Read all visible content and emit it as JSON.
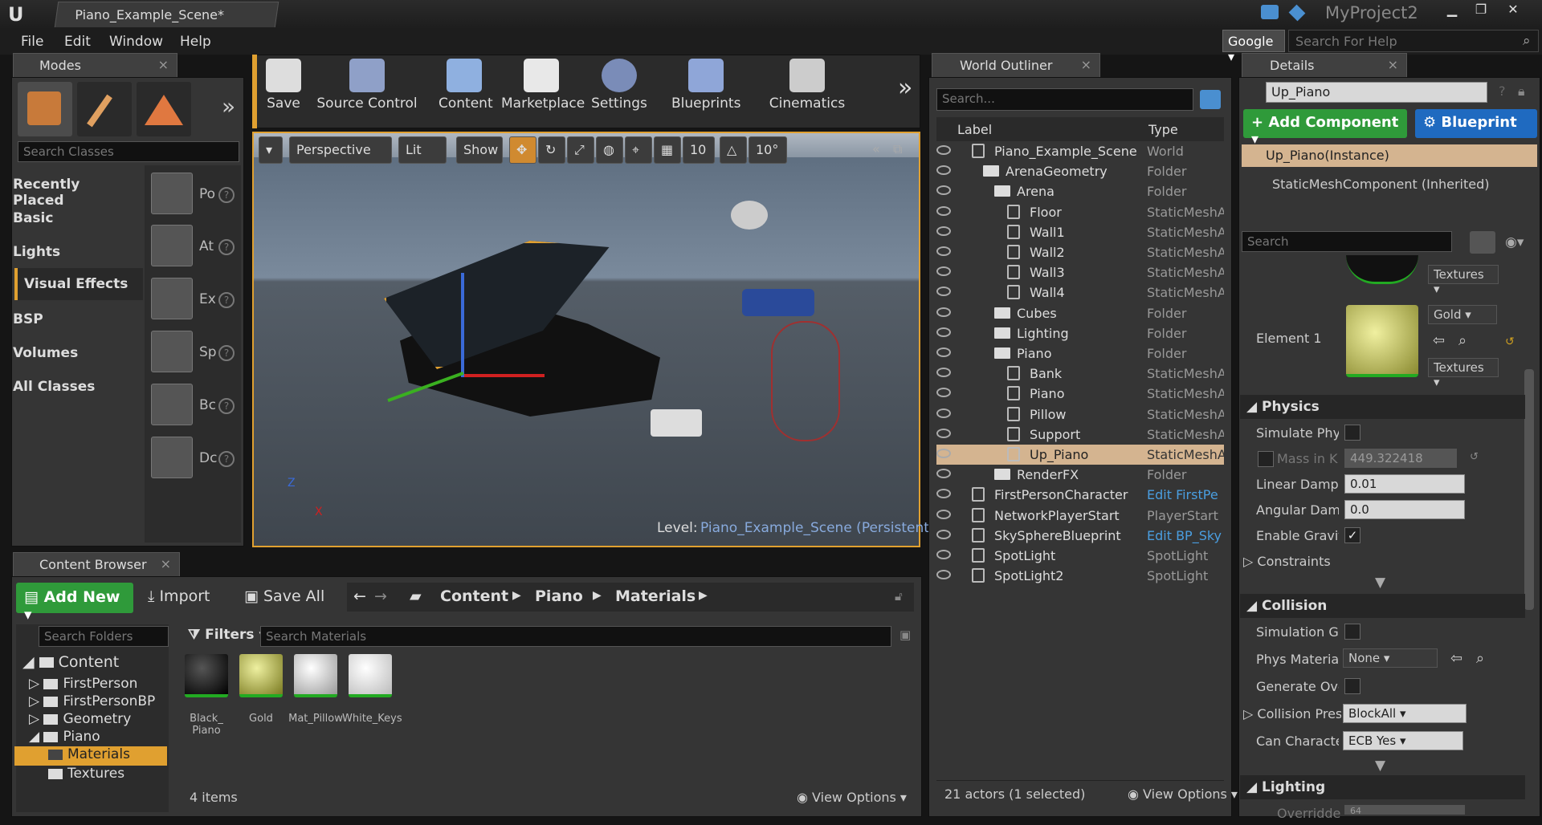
{
  "app": {
    "tab_title": "Piano_Example_Scene*",
    "project": "MyProject2",
    "logo": "U"
  },
  "menu": [
    "File",
    "Edit",
    "Window",
    "Help"
  ],
  "help": {
    "engine": "Google",
    "placeholder": "Search For Help"
  },
  "modes": {
    "tab": "Modes",
    "search_placeholder": "Search Classes",
    "categories": [
      "Recently Placed",
      "Basic",
      "Lights",
      "Visual Effects",
      "BSP",
      "Volumes",
      "All Classes"
    ],
    "placeables": [
      "Po",
      "At",
      "Ex",
      "Sp",
      "Bc",
      "Dc"
    ]
  },
  "toolbar": [
    "Save",
    "Source Control",
    "Content",
    "Marketplace",
    "Settings",
    "Blueprints",
    "Cinematics"
  ],
  "viewport": {
    "perspective": "Perspective",
    "lit": "Lit",
    "show": "Show",
    "grid": "10",
    "angle": "10°",
    "level_label": "Level:",
    "level_name": "Piano_Example_Scene (Persistent)",
    "axis_z": "Z",
    "axis_x": "X"
  },
  "outliner": {
    "tab": "World Outliner",
    "search_placeholder": "Search...",
    "col_label": "Label",
    "col_type": "Type",
    "rows": [
      {
        "label": "Piano_Example_Scene",
        "type": "World"
      },
      {
        "label": "ArenaGeometry",
        "type": "Folder"
      },
      {
        "label": "Arena",
        "type": "Folder"
      },
      {
        "label": "Floor",
        "type": "StaticMeshA"
      },
      {
        "label": "Wall1",
        "type": "StaticMeshA"
      },
      {
        "label": "Wall2",
        "type": "StaticMeshA"
      },
      {
        "label": "Wall3",
        "type": "StaticMeshA"
      },
      {
        "label": "Wall4",
        "type": "StaticMeshA"
      },
      {
        "label": "Cubes",
        "type": "Folder"
      },
      {
        "label": "Lighting",
        "type": "Folder"
      },
      {
        "label": "Piano",
        "type": "Folder"
      },
      {
        "label": "Bank",
        "type": "StaticMeshA"
      },
      {
        "label": "Piano",
        "type": "StaticMeshA"
      },
      {
        "label": "Pillow",
        "type": "StaticMeshA"
      },
      {
        "label": "Support",
        "type": "StaticMeshA"
      },
      {
        "label": "Up_Piano",
        "type": "StaticMeshA"
      },
      {
        "label": "RenderFX",
        "type": "Folder"
      },
      {
        "label": "FirstPersonCharacter",
        "type": "Edit FirstPe"
      },
      {
        "label": "NetworkPlayerStart",
        "type": "PlayerStart"
      },
      {
        "label": "SkySphereBlueprint",
        "type": "Edit BP_Sky"
      },
      {
        "label": "SpotLight",
        "type": "SpotLight"
      },
      {
        "label": "SpotLight2",
        "type": "SpotLight"
      }
    ],
    "status": "21 actors (1 selected)",
    "view_options": "View Options"
  },
  "details": {
    "tab": "Details",
    "actor_name": "Up_Piano",
    "add_component": "+ Add Component",
    "blueprint": "Blueprint",
    "instance": "Up_Piano(Instance)",
    "component": "StaticMeshComponent (Inherited)",
    "search_placeholder": "Search",
    "textures": "Textures",
    "element1": "Element 1",
    "gold": "Gold",
    "physics": "Physics",
    "simulate": "Simulate Phys",
    "mass": "Mass in K",
    "mass_value": "449.322418",
    "linear": "Linear Dampin",
    "linear_value": "0.01",
    "angular": "Angular Damp",
    "angular_value": "0.0",
    "gravity": "Enable Gravity",
    "constraints": "Constraints",
    "collision": "Collision",
    "sim_gen": "Simulation Ge",
    "phys_mat": "Phys Material",
    "phys_mat_value": "None",
    "gen_over": "Generate Over",
    "coll_preset": "Collision Pres",
    "coll_preset_value": "BlockAll",
    "can_char": "Can Character",
    "can_char_value": "ECB Yes",
    "lighting": "Lighting",
    "override": "Overridden",
    "override_value": "64"
  },
  "content": {
    "tab": "Content Browser",
    "add_new": "Add New",
    "import": "Import",
    "save_all": "Save All",
    "path": [
      "Content",
      "Piano",
      "Materials"
    ],
    "folder_search": "Search Folders",
    "filters": "Filters",
    "mat_search": "Search Materials",
    "tree": [
      "Content",
      "FirstPerson",
      "FirstPersonBP",
      "Geometry",
      "Piano",
      "Materials",
      "Textures"
    ],
    "materials": [
      "Black_\nPiano",
      "Gold",
      "Mat_Pillow",
      "White_Keys"
    ],
    "count": "4 items",
    "view_options": "View Options"
  }
}
